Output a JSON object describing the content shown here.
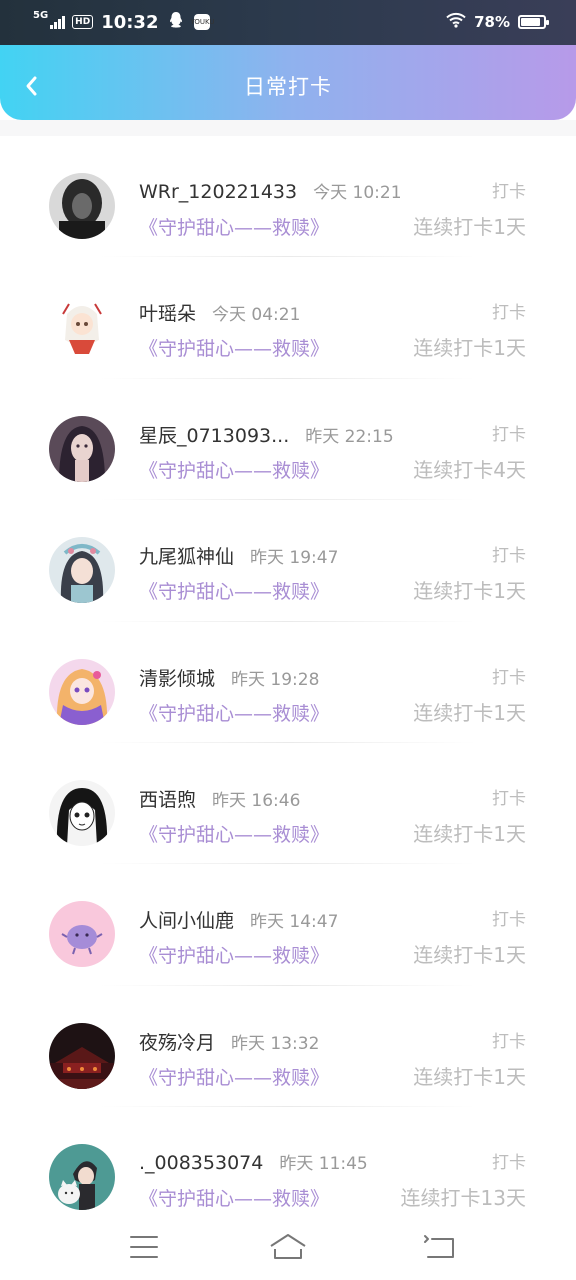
{
  "status_bar": {
    "network": "5G",
    "hd": "HD",
    "time": "10:32",
    "app_icon_label": "YOUKU",
    "battery_percent": "78%",
    "battery_level": 0.78
  },
  "header": {
    "title": "日常打卡"
  },
  "list": [
    {
      "name": "WRr_120221433",
      "time": "今天 10:21",
      "action": "打卡",
      "book": "《守护甜心——救赎》",
      "streak": "连续打卡1天",
      "avatar": "dark-portrait"
    },
    {
      "name": "叶瑶朵",
      "time": "今天 04:21",
      "action": "打卡",
      "book": "《守护甜心——救赎》",
      "streak": "连续打卡1天",
      "avatar": "white-hair-chibi"
    },
    {
      "name": "星辰_0713093...",
      "time": "昨天 22:15",
      "action": "打卡",
      "book": "《守护甜心——救赎》",
      "streak": "连续打卡4天",
      "avatar": "dark-hair-girl"
    },
    {
      "name": "九尾狐神仙",
      "time": "昨天 19:47",
      "action": "打卡",
      "book": "《守护甜心——救赎》",
      "streak": "连续打卡1天",
      "avatar": "fairy-girl"
    },
    {
      "name": "清影倾城",
      "time": "昨天 19:28",
      "action": "打卡",
      "book": "《守护甜心——救赎》",
      "streak": "连续打卡1天",
      "avatar": "pink-anime-girl"
    },
    {
      "name": "西语煦",
      "time": "昨天 16:46",
      "action": "打卡",
      "book": "《守护甜心——救赎》",
      "streak": "连续打卡1天",
      "avatar": "manga-girl"
    },
    {
      "name": "人间小仙鹿",
      "time": "昨天 14:47",
      "action": "打卡",
      "book": "《守护甜心——救赎》",
      "streak": "连续打卡1天",
      "avatar": "purple-blob"
    },
    {
      "name": "夜殇冷月",
      "time": "昨天 13:32",
      "action": "打卡",
      "book": "《守护甜心——救赎》",
      "streak": "连续打卡1天",
      "avatar": "night-temple"
    },
    {
      "name": "._008353074",
      "time": "昨天 11:45",
      "action": "打卡",
      "book": "《守护甜心——救赎》",
      "streak": "连续打卡13天",
      "avatar": "boy-with-cat"
    }
  ],
  "nav": {
    "buttons": [
      "menu-icon",
      "home-icon",
      "back-icon"
    ]
  }
}
